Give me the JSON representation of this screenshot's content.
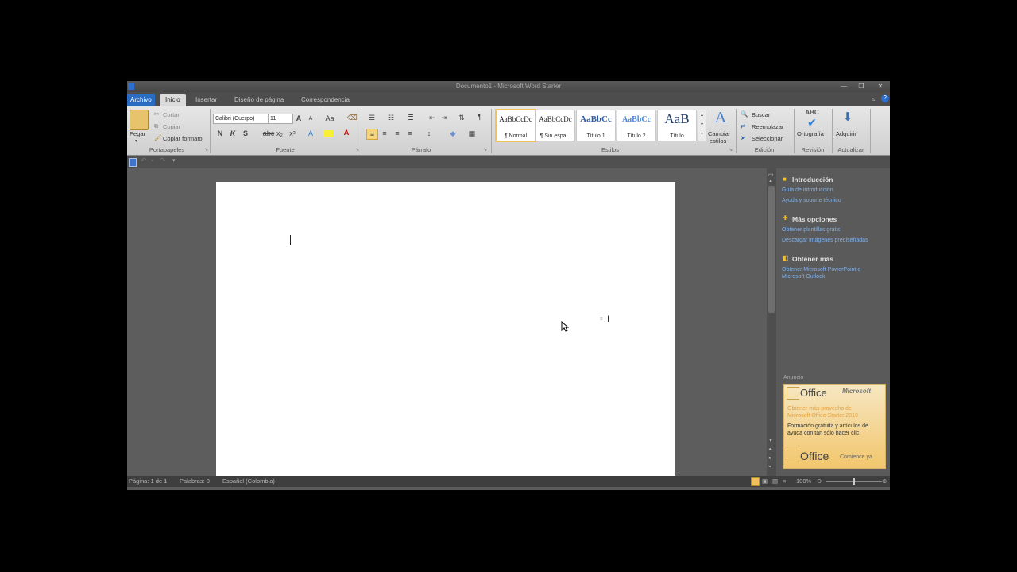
{
  "window": {
    "title": "Documento1 - Microsoft Word Starter",
    "minimize_icon": "minimize-icon",
    "restore_icon": "restore-icon",
    "close_icon": "close-icon"
  },
  "tabs": [
    {
      "label": "Archivo"
    },
    {
      "label": "Inicio"
    },
    {
      "label": "Insertar"
    },
    {
      "label": "Diseño de página"
    },
    {
      "label": "Correspondencia"
    }
  ],
  "ribbon": {
    "clipboard": {
      "paste": "Pegar",
      "cut": "Cortar",
      "copy": "Copiar",
      "format_painter": "Copiar formato",
      "label": "Portapapeles"
    },
    "font": {
      "font_name": "Calibri (Cuerpo)",
      "font_size": "11",
      "label": "Fuente",
      "bold": "N",
      "italic": "K",
      "underline": "S",
      "strike": "abc",
      "subscript": "x₂",
      "superscript": "x²",
      "grow": "A",
      "shrink": "A",
      "case": "Aa",
      "font_color": "A"
    },
    "paragraph": {
      "label": "Párrafo",
      "pilcrow": "¶"
    },
    "styles": {
      "label": "Estilos",
      "items": [
        {
          "sample": "AaBbCcDc",
          "name": "¶ Normal"
        },
        {
          "sample": "AaBbCcDc",
          "name": "¶ Sin espa..."
        },
        {
          "sample": "AaBbCc",
          "name": "Título 1"
        },
        {
          "sample": "AaBbCc",
          "name": "Título 2"
        },
        {
          "sample": "AaB",
          "name": "Título"
        }
      ],
      "change_styles_line1": "Cambiar",
      "change_styles_line2": "estilos"
    },
    "editing": {
      "label": "Edición",
      "find": "Buscar",
      "replace": "Reemplazar",
      "select": "Seleccionar"
    },
    "review": {
      "label": "Revisión",
      "spelling": "Ortografía"
    },
    "update": {
      "label": "Actualizar",
      "acquire": "Adquirir"
    }
  },
  "pane": {
    "intro_title": "Introducción",
    "intro_links": [
      "Guía de introducción",
      "Ayuda y soporte técnico"
    ],
    "more_title": "Más opciones",
    "more_links": [
      "Obtener plantillas gratis",
      "Descargar imágenes prediseñadas"
    ],
    "get_title": "Obtener más",
    "get_links": [
      "Obtener Microsoft PowerPoint o",
      "Microsoft Outlook"
    ],
    "ad_label": "Anuncio",
    "ad": {
      "brand": "Office",
      "microsoft": "Microsoft",
      "line1": "Obtener más provecho de",
      "line2": "Microsoft Office Starter 2010",
      "line3": "Formación gratuita y artículos de",
      "line4": "ayuda con tan sólo hacer clic",
      "brand2": "Office",
      "cta": "Comience ya"
    }
  },
  "status": {
    "page": "Página: 1 de 1",
    "words": "Palabras: 0",
    "language": "Español (Colombia)",
    "zoom": "100%"
  }
}
